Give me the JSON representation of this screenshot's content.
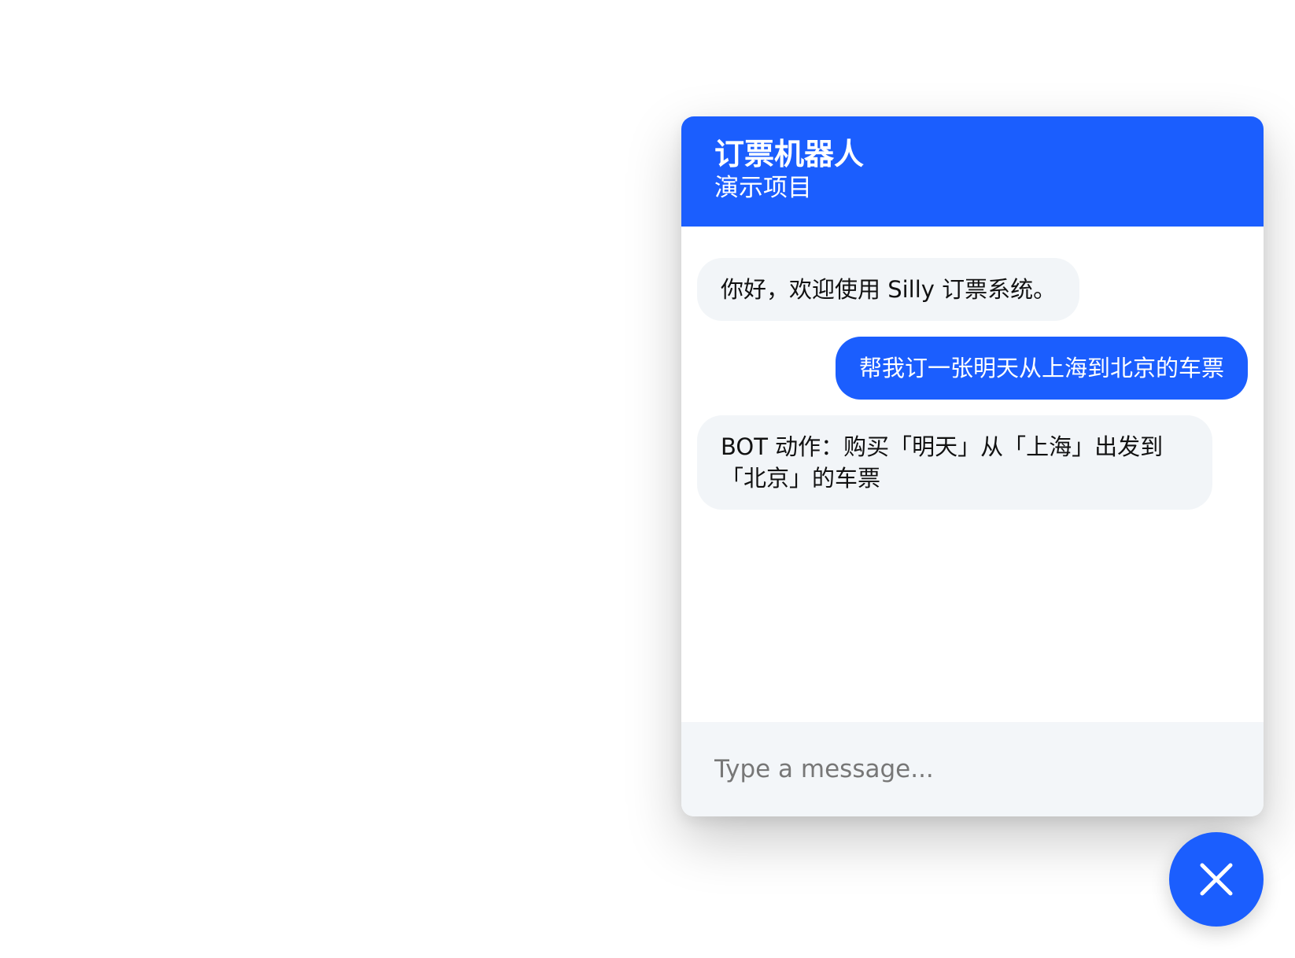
{
  "header": {
    "title": "订票机器人",
    "subtitle": "演示项目"
  },
  "messages": [
    {
      "sender": "bot",
      "text": "你好，欢迎使用 Silly 订票系统。"
    },
    {
      "sender": "user",
      "text": "帮我订一张明天从上海到北京的车票"
    },
    {
      "sender": "bot",
      "text": "BOT 动作：购买「明天」从「上海」出发到「北京」的车票"
    }
  ],
  "composer": {
    "placeholder": "Type a message..."
  },
  "fab": {
    "icon": "close-icon"
  },
  "colors": {
    "accent": "#1b5efe",
    "bot_bubble": "#f2f5f8",
    "input_bg": "#f3f6f9"
  }
}
